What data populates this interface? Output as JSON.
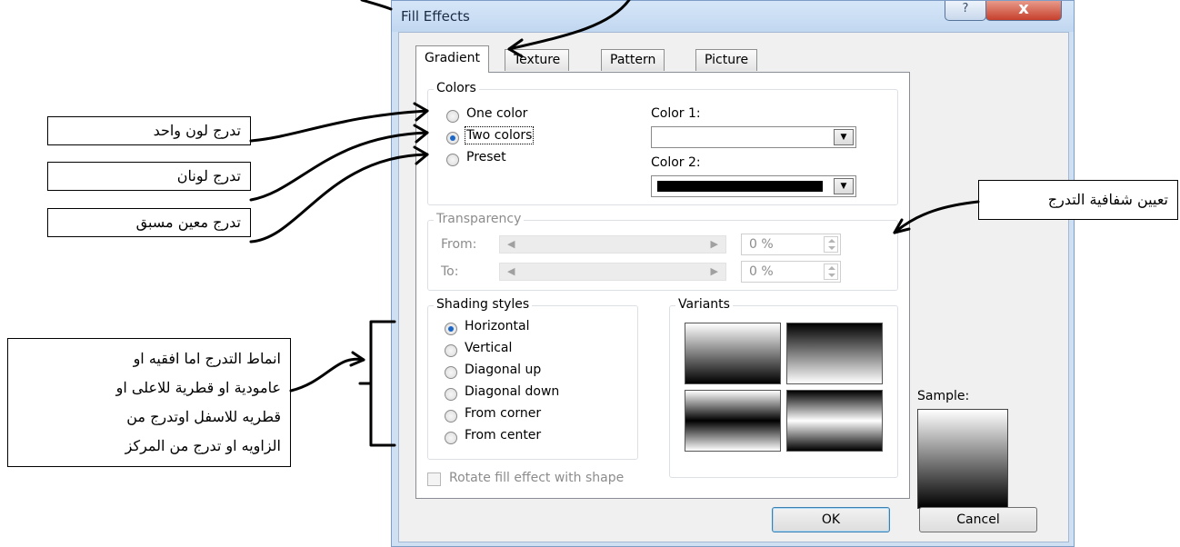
{
  "dialog": {
    "title": "Fill Effects",
    "help_label": "?",
    "close_label": "x"
  },
  "tabs": [
    {
      "label": "Gradient",
      "active": true
    },
    {
      "label": "Texture",
      "active": false
    },
    {
      "label": "Pattern",
      "active": false
    },
    {
      "label": "Picture",
      "active": false
    }
  ],
  "colors": {
    "legend": "Colors",
    "options": [
      {
        "label": "One color",
        "selected": false
      },
      {
        "label": "Two colors",
        "selected": true
      },
      {
        "label": "Preset",
        "selected": false
      }
    ],
    "color1_label": "Color 1:",
    "color1_value": "#ffffff",
    "color2_label": "Color 2:",
    "color2_value": "#000000"
  },
  "transparency": {
    "legend": "Transparency",
    "from_label": "From:",
    "from_value": "0 %",
    "to_label": "To:",
    "to_value": "0 %"
  },
  "shading": {
    "legend": "Shading styles",
    "options": [
      {
        "label": "Horizontal",
        "selected": true
      },
      {
        "label": "Vertical",
        "selected": false
      },
      {
        "label": "Diagonal up",
        "selected": false
      },
      {
        "label": "Diagonal down",
        "selected": false
      },
      {
        "label": "From corner",
        "selected": false
      },
      {
        "label": "From center",
        "selected": false
      }
    ]
  },
  "variants": {
    "legend": "Variants"
  },
  "sample_label": "Sample:",
  "rotate_label": "Rotate fill effect with shape",
  "buttons": {
    "ok": "OK",
    "cancel": "Cancel"
  },
  "annotations": {
    "one_color": "تدرج لون واحد",
    "two_colors": "تدرج لونان",
    "preset": "تدرج معين مسبق",
    "transparency": "تعيين شفافية التدرج",
    "shading_lines": [
      "انماط التدرج اما افقيه او",
      "عامودية او قطرية للاعلى او",
      "قطريه للاسفل اوتدرج من",
      "الزاويه او تدرج من المركز"
    ]
  }
}
